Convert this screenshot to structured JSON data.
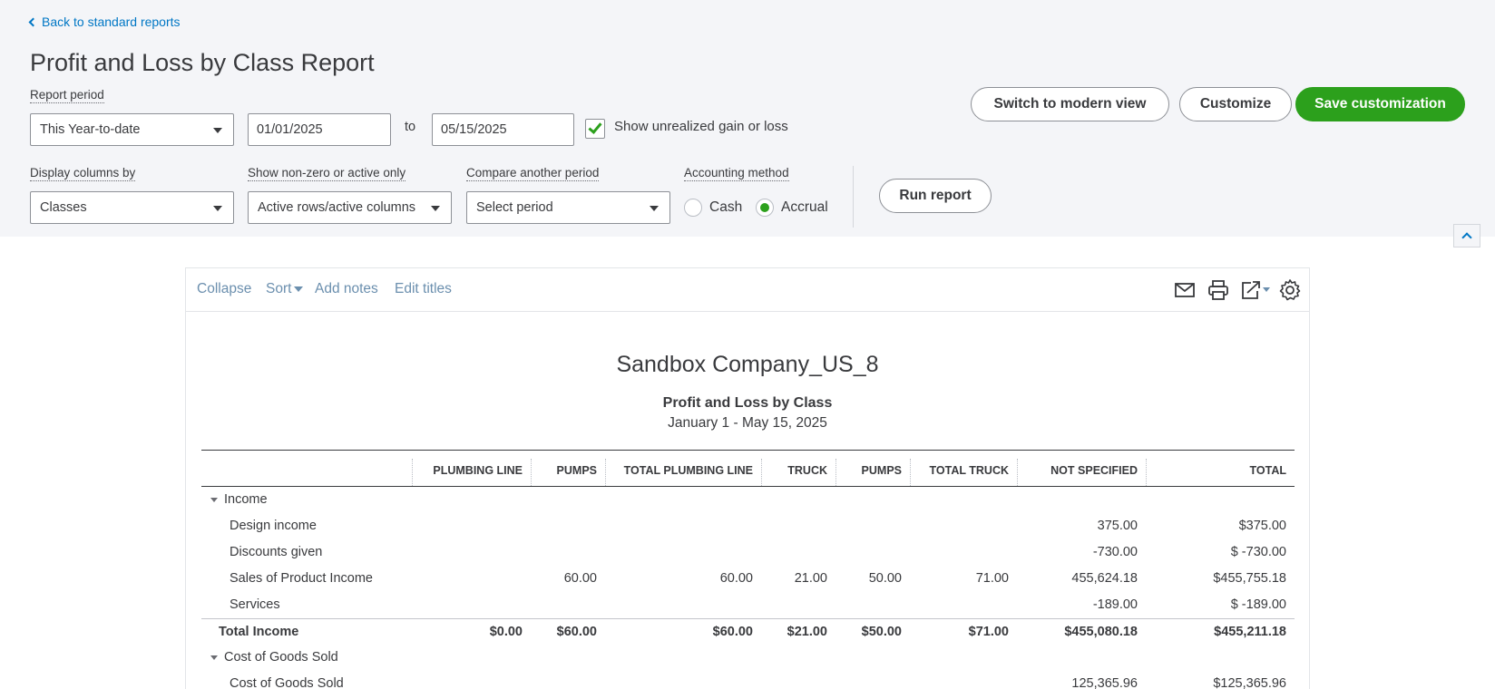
{
  "nav": {
    "back_label": "Back to standard reports"
  },
  "page": {
    "title": "Profit and Loss by Class Report"
  },
  "filters": {
    "report_period_label": "Report period",
    "report_period_value": "This Year-to-date",
    "from_date": "01/01/2025",
    "to_label": "to",
    "to_date": "05/15/2025",
    "unrealized_label": "Show unrealized gain or loss",
    "unrealized_checked": true,
    "display_columns_label": "Display columns by",
    "display_columns_value": "Classes",
    "nonzero_label": "Show non-zero or active only",
    "nonzero_value": "Active rows/active columns",
    "compare_label": "Compare another period",
    "compare_value": "Select period",
    "accounting_label": "Accounting method",
    "cash_label": "Cash",
    "accrual_label": "Accrual",
    "accounting_selected": "Accrual"
  },
  "actions": {
    "modern_view": "Switch to modern view",
    "customize": "Customize",
    "save": "Save customization",
    "run": "Run report"
  },
  "toolbar": {
    "collapse": "Collapse",
    "sort": "Sort",
    "add_notes": "Add notes",
    "edit_titles": "Edit titles",
    "icons": [
      "email-icon",
      "print-icon",
      "export-icon",
      "gear-icon"
    ]
  },
  "report": {
    "company": "Sandbox Company_US_8",
    "title": "Profit and Loss by Class",
    "date_range": "January 1 - May 15, 2025",
    "columns": [
      "PLUMBING LINE",
      "PUMPS",
      "TOTAL PLUMBING LINE",
      "TRUCK",
      "PUMPS",
      "TOTAL TRUCK",
      "NOT SPECIFIED",
      "TOTAL"
    ],
    "rows": [
      {
        "label": "Income",
        "type": "section",
        "values": [
          "",
          "",
          "",
          "",
          "",
          "",
          "",
          ""
        ]
      },
      {
        "label": "Design income",
        "type": "item",
        "values": [
          "",
          "",
          "",
          "",
          "",
          "",
          "375.00",
          "$375.00"
        ]
      },
      {
        "label": "Discounts given",
        "type": "item",
        "values": [
          "",
          "",
          "",
          "",
          "",
          "",
          "-730.00",
          "$ -730.00"
        ]
      },
      {
        "label": "Sales of Product Income",
        "type": "item",
        "values": [
          "",
          "60.00",
          "60.00",
          "21.00",
          "50.00",
          "71.00",
          "455,624.18",
          "$455,755.18"
        ]
      },
      {
        "label": "Services",
        "type": "item",
        "values": [
          "",
          "",
          "",
          "",
          "",
          "",
          "-189.00",
          "$ -189.00"
        ]
      },
      {
        "label": "Total Income",
        "type": "total",
        "values": [
          "$0.00",
          "$60.00",
          "$60.00",
          "$21.00",
          "$50.00",
          "$71.00",
          "$455,080.18",
          "$455,211.18"
        ]
      },
      {
        "label": "Cost of Goods Sold",
        "type": "section",
        "values": [
          "",
          "",
          "",
          "",
          "",
          "",
          "",
          ""
        ]
      },
      {
        "label": "Cost of Goods Sold",
        "type": "item",
        "values": [
          "",
          "",
          "",
          "",
          "",
          "",
          "125,365.96",
          "$125,365.96"
        ]
      }
    ]
  },
  "colors": {
    "accent_green": "#2ca01c",
    "link_blue": "#0077c5",
    "panel_bg": "#f4f5f8"
  }
}
